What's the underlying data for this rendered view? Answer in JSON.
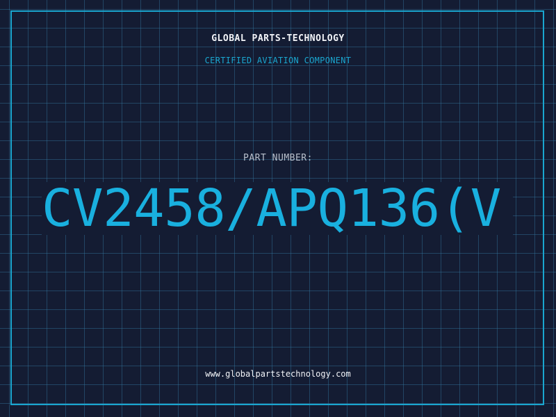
{
  "company": {
    "name": "GLOBAL PARTS-TECHNOLOGY",
    "subtitle": "CERTIFIED AVIATION COMPONENT"
  },
  "part": {
    "label": "PART NUMBER:",
    "number": "CV2458/APQ136(V"
  },
  "footer": {
    "website": "www.globalpartstechnology.com"
  },
  "colors": {
    "background": "#141c33",
    "grid": "#34789f",
    "accent": "#19b0df",
    "text": "#f2f4f8",
    "muted": "#b8c0cc"
  }
}
